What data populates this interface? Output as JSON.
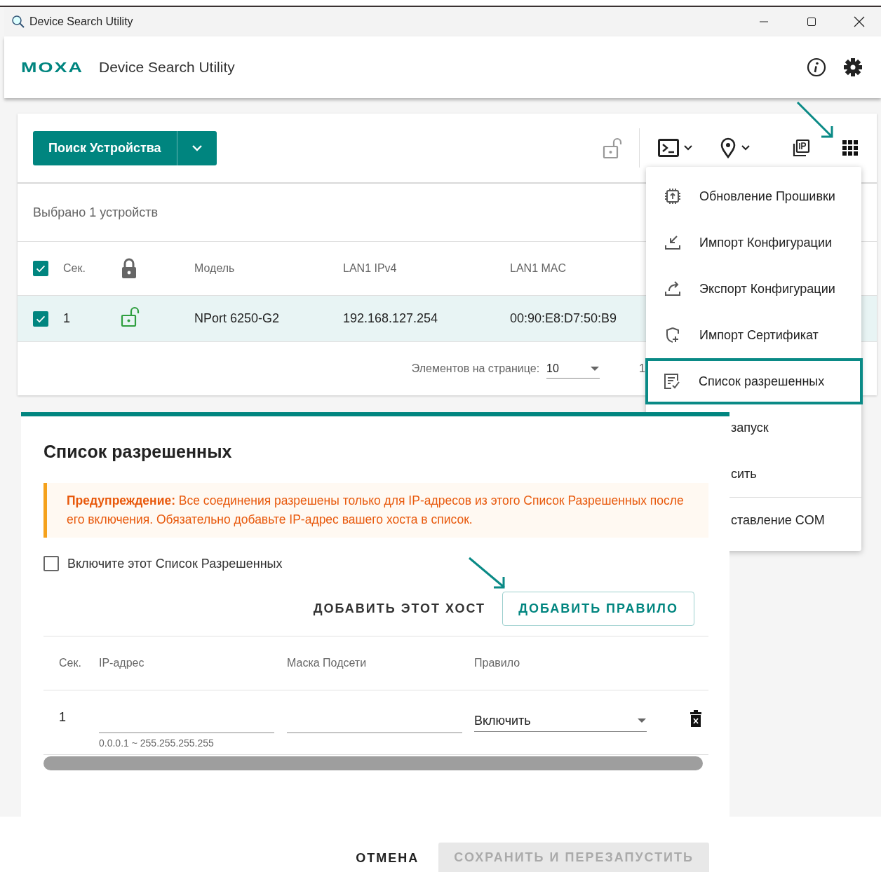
{
  "window": {
    "title": "Device Search Utility"
  },
  "header": {
    "logo": "MOXA",
    "title": "Device Search Utility"
  },
  "toolbar": {
    "search_button": "Поиск Устройства"
  },
  "devices": {
    "selected_count": "Выбрано 1 устройств",
    "all_checked": true,
    "columns": [
      {
        "kind": "text",
        "label": "Сек."
      },
      {
        "kind": "lock"
      },
      {
        "kind": "text",
        "label": "Модель"
      },
      {
        "kind": "text",
        "label": "LAN1 IPv4"
      },
      {
        "kind": "text",
        "label": "LAN1 MAC"
      }
    ],
    "rows": [
      {
        "index": "1",
        "checked": true,
        "locked": false,
        "model": "NPort 6250-G2",
        "ipv4": "192.168.127.254",
        "mac": "00:90:E8:D7:50:B9"
      }
    ],
    "pagination": {
      "label": "Элементов на странице:",
      "page_size": "10",
      "range": "1"
    }
  },
  "menu": {
    "items": [
      {
        "kind": "firmware",
        "label": "Обновление Прошивки",
        "highlighted": false,
        "separator": false
      },
      {
        "kind": "import",
        "label": "Импорт Конфигурации",
        "highlighted": false,
        "separator": false
      },
      {
        "kind": "export",
        "label": "Экспорт Конфигурации",
        "highlighted": false,
        "separator": false
      },
      {
        "kind": "certificate",
        "label": "Импорт Сертификат",
        "highlighted": false,
        "separator": false
      },
      {
        "kind": "allowlist",
        "label": "Список разрешенных",
        "highlighted": true,
        "separator": false
      },
      {
        "kind": "covered",
        "label": "запуск",
        "highlighted": false,
        "separator": false
      },
      {
        "kind": "covered",
        "label": "сить",
        "highlighted": false,
        "separator": false
      },
      {
        "kind": "covered",
        "label": "ставление COM",
        "highlighted": false,
        "separator": true
      }
    ]
  },
  "dialog": {
    "title": "Список разрешенных",
    "warning": "**Предупреждение:** Все соединения разрешены только для IP-адресов из этого Список Разрешенных после его включения. Обязательно добавьте IP-адрес вашего хоста в список.",
    "enable_label": "Включите этот Список Разрешенных",
    "enabled": false,
    "add_host": "ДОБАВИТЬ ЭТОТ ХОСТ",
    "add_rule": "ДОБАВИТЬ ПРАВИЛО",
    "columns": [
      "Сек.",
      "IP-адрес",
      "Маска Подсети",
      "Правило"
    ],
    "rules": [
      {
        "index": "1",
        "ip_hint": "0.0.0.1 ~ 255.255.255.255",
        "rule": "Включить"
      }
    ],
    "cancel": "ОТМЕНА",
    "save": "СОХРАНИТЬ И ПЕРЕЗАПУСТИТЬ",
    "save_disabled": true
  }
}
